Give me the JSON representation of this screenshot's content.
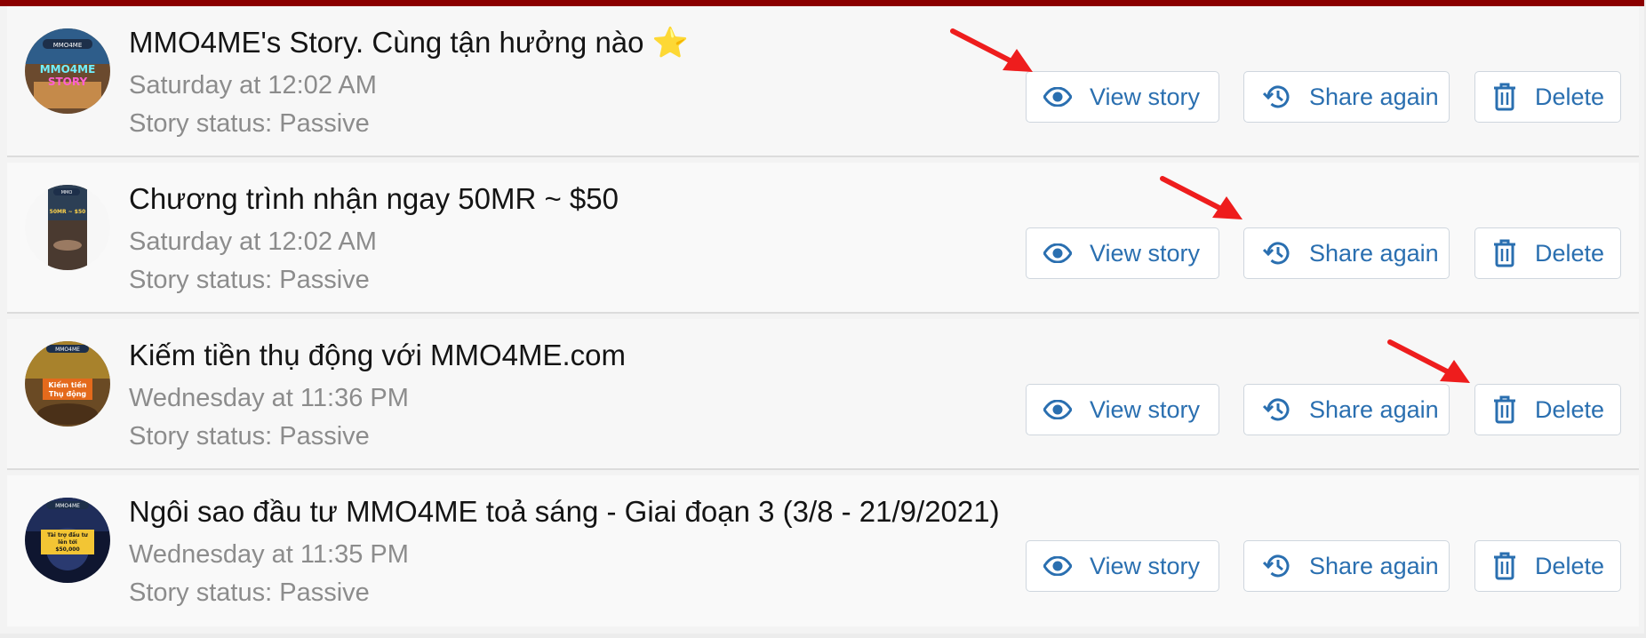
{
  "accent_color": "#8b0000",
  "link_color": "#2a6fb0",
  "annotation_color": "#ee1d1d",
  "stories": [
    {
      "title": "MMO4ME's Story. Cùng tận hưởng nào ⭐",
      "date": "Saturday at 12:02 AM",
      "status": "Story status: Passive",
      "thumb_text": "MMO4ME STORY",
      "thumb_badge": "MMO4ME"
    },
    {
      "title": "Chương trình nhận ngay 50MR ~ $50",
      "date": "Saturday at 12:02 AM",
      "status": "Story status: Passive",
      "thumb_text": "50MR ~ $50",
      "thumb_badge": "MMO"
    },
    {
      "title": "Kiếm tiền thụ động với MMO4ME.com",
      "date": "Wednesday at 11:36 PM",
      "status": "Story status: Passive",
      "thumb_text": "Kiếm tiền Thụ động",
      "thumb_badge": "MMO4ME"
    },
    {
      "title": "Ngôi sao đầu tư MMO4ME toả sáng - Giai đoạn 3 (3/8 - 21/9/2021)",
      "date": "Wednesday at 11:35 PM",
      "status": "Story status: Passive",
      "thumb_text": "Tài trợ đầu tư lên tới $50,000",
      "thumb_badge": "MMO4ME"
    }
  ],
  "actions": {
    "view_label": "View story",
    "share_label": "Share again",
    "delete_label": "Delete"
  },
  "icons": {
    "view": "eye-icon",
    "share": "history-icon",
    "delete": "trash-icon"
  }
}
